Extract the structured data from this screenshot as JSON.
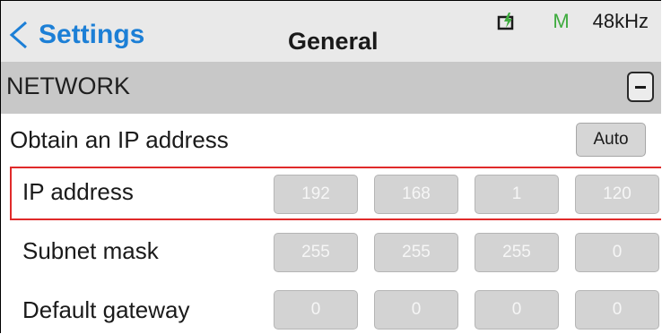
{
  "header": {
    "back_label": "Settings",
    "title": "General",
    "mode": "M",
    "sample_rate": "48kHz"
  },
  "section": {
    "label": "NETWORK"
  },
  "rows": {
    "obtain_ip": {
      "label": "Obtain an IP address",
      "button": "Auto"
    },
    "ip_address": {
      "label": "IP address",
      "octets": [
        "192",
        "168",
        "1",
        "120"
      ]
    },
    "subnet_mask": {
      "label": "Subnet mask",
      "octets": [
        "255",
        "255",
        "255",
        "0"
      ]
    },
    "default_gateway": {
      "label": "Default gateway",
      "octets": [
        "0",
        "0",
        "0",
        "0"
      ]
    }
  },
  "colors": {
    "accent_blue": "#1c7fd6",
    "mode_green": "#3eab3e",
    "highlight_red": "#e02a2a"
  }
}
